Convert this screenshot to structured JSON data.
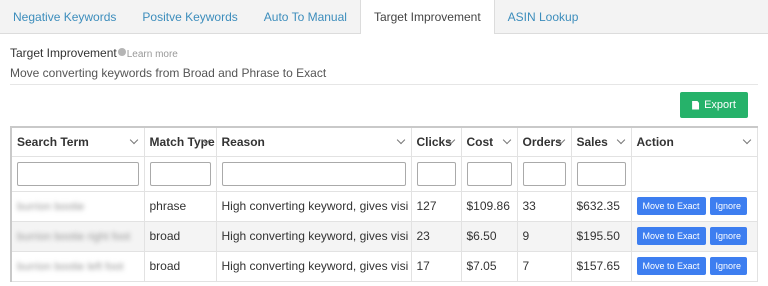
{
  "tabs": [
    "Negative Keywords",
    "Positve Keywords",
    "Auto To Manual",
    "Target Improvement",
    "ASIN Lookup"
  ],
  "panel": {
    "title": "Target Improvement",
    "learn_more": "Learn more",
    "subtitle": "Move converting keywords from Broad and Phrase to Exact",
    "export_label": "Export"
  },
  "table": {
    "columns": [
      "Search Term",
      "Match Type",
      "Reason",
      "Clicks",
      "Cost",
      "Orders",
      "Sales",
      "Action"
    ],
    "rows": [
      {
        "term": "burrion bootie",
        "match": "phrase",
        "reason": "High converting keyword, gives visi",
        "clicks": "127",
        "cost": "$109.86",
        "orders": "33",
        "sales": "$632.35"
      },
      {
        "term": "burrion bootie right foot",
        "match": "broad",
        "reason": "High converting keyword, gives visi",
        "clicks": "23",
        "cost": "$6.50",
        "orders": "9",
        "sales": "$195.50"
      },
      {
        "term": "burrion bootie left foot",
        "match": "broad",
        "reason": "High converting keyword, gives visi",
        "clicks": "17",
        "cost": "$7.05",
        "orders": "7",
        "sales": "$157.65"
      }
    ],
    "move_label": "Move to Exact",
    "ignore_label": "Ignore"
  },
  "colors": {
    "accent": "#3c8dbc",
    "export_green": "#26b26a",
    "action_blue": "#3d7ef0"
  }
}
